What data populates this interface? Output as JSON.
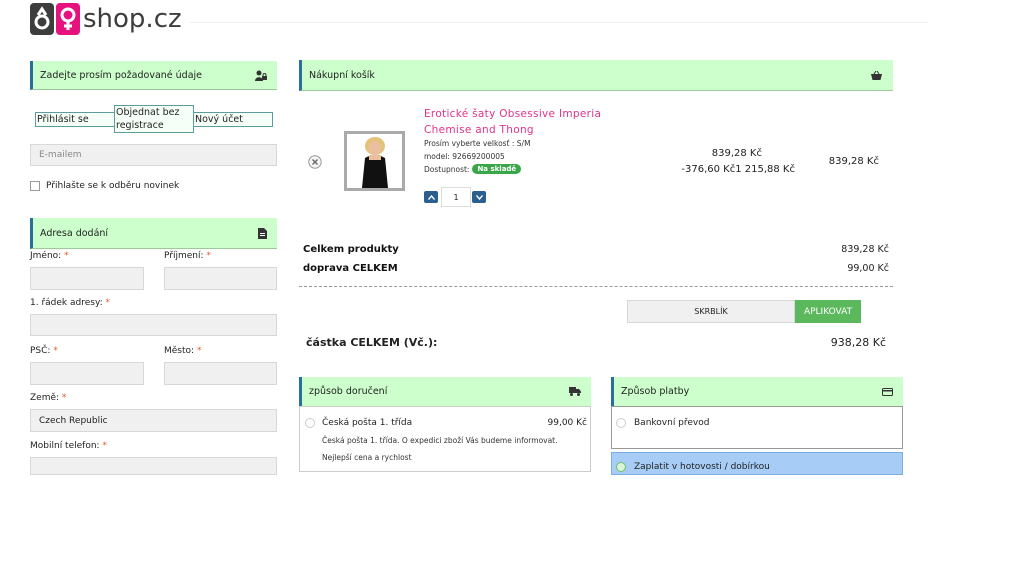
{
  "logo": {
    "text": "shop.cz",
    "symbol_colors": [
      "#3d3d3d",
      "#e6137f"
    ]
  },
  "left": {
    "details_title": "Zadejte prosím požadované údaje",
    "tabs": [
      {
        "label": "Přihlásit se"
      },
      {
        "label": "Objednat bez registrace"
      },
      {
        "label": "Nový účet"
      }
    ],
    "email_placeholder": "E-mailem",
    "newsletter_label": "Přihlašte se k odběru novinek",
    "address_title": "Adresa dodání",
    "first_name_label": "Jméno:",
    "last_name_label": "Příjmení:",
    "address1_label": "1. řádek adresy:",
    "zip_label": "PSČ:",
    "city_label": "Město:",
    "country_label": "Země:",
    "country_value": "Czech Republic",
    "phone_label": "Mobilní telefon:",
    "required_mark": "*"
  },
  "cart": {
    "title": "Nákupní košík",
    "product": {
      "name": "Erotické šaty Obsessive Imperia Chemise and Thong",
      "size": "Prosím vyberte velkosť : S/M",
      "model": "model: 92669200005",
      "availability_label": "Dostupnost:",
      "availability_badge": "Na skladě",
      "quantity": "1",
      "price": "839,28 Kč",
      "discount": "-376,60 Kč1 215,88 Kč",
      "line_total": "839,28 Kč"
    },
    "subtotal_label": "Celkem produkty",
    "subtotal_value": "839,28 Kč",
    "shipping_label": "doprava CELKEM",
    "shipping_value": "99,00 Kč",
    "coupon_value": "SKRBLÍK",
    "apply_label": "APLIKOVAT",
    "grand_total_label": "částka CELKEM (Vč.):",
    "grand_total_value": "938,28 Kč"
  },
  "delivery": {
    "title": "způsob doručení",
    "option_name": "Česká pošta 1. třída",
    "option_price": "99,00 Kč",
    "option_desc": "Česká pošta 1. třída. O expedici zboží Vás budeme informovat.",
    "option_note": "Nejlepší cena a rychlost"
  },
  "payment": {
    "title": "Způsob platby",
    "option1": "Bankovní převod",
    "option2": "Zaplatit v hotovosti / dobírkou"
  },
  "colors": {
    "accent_green": "#ccffcc",
    "brand_pink": "#e6137f",
    "apply_green": "#5cb85c",
    "selected_blue": "#a7cdf7"
  }
}
